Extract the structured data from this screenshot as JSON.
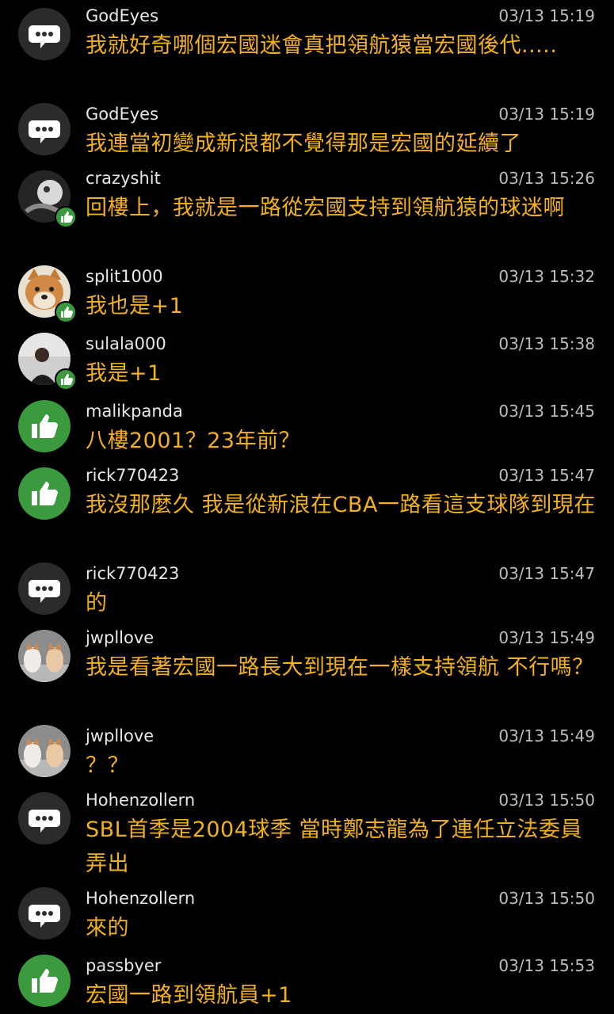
{
  "comments": [
    {
      "user": "GodEyes",
      "time": "03/13 15:19",
      "text": "我就好奇哪個宏國迷會真把領航猿當宏國後代.....",
      "avatar": "speech-bubble-icon",
      "badge": false
    },
    {
      "user": "GodEyes",
      "time": "03/13 15:19",
      "text": "我連當初變成新浪都不覺得那是宏國的延續了",
      "avatar": "speech-bubble-icon",
      "badge": false
    },
    {
      "user": "crazyshit",
      "time": "03/13 15:26",
      "text": "回樓上，我就是一路從宏國支持到領航猿的球迷啊",
      "avatar": "user-photo",
      "badge": true
    },
    {
      "user": "split1000",
      "time": "03/13 15:32",
      "text": "我也是+1",
      "avatar": "dog-photo",
      "badge": true
    },
    {
      "user": "sulala000",
      "time": "03/13 15:38",
      "text": "我是+1",
      "avatar": "user-photo",
      "badge": true
    },
    {
      "user": "malikpanda",
      "time": "03/13 15:45",
      "text": "八樓2001？23年前？",
      "avatar": "thumbs-up-icon",
      "badge": false
    },
    {
      "user": "rick770423",
      "time": "03/13 15:47",
      "text": "我沒那麼久 我是從新浪在CBA一路看這支球隊到現在",
      "avatar": "thumbs-up-icon",
      "badge": false
    },
    {
      "user": "rick770423",
      "time": "03/13 15:47",
      "text": "的",
      "avatar": "speech-bubble-icon",
      "badge": false
    },
    {
      "user": "jwpllove",
      "time": "03/13 15:49",
      "text": "我是看著宏國一路長大到現在一樣支持領航 不行嗎？",
      "avatar": "cats-photo",
      "badge": false
    },
    {
      "user": "jwpllove",
      "time": "03/13 15:49",
      "text": "？？",
      "avatar": "cats-photo",
      "badge": false
    },
    {
      "user": "Hohenzollern",
      "time": "03/13 15:50",
      "text": "SBL首季是2004球季 當時鄭志龍為了連任立法委員弄出",
      "avatar": "speech-bubble-icon",
      "badge": false
    },
    {
      "user": "Hohenzollern",
      "time": "03/13 15:50",
      "text": "來的",
      "avatar": "speech-bubble-icon",
      "badge": false
    },
    {
      "user": "passbyer",
      "time": "03/13 15:53",
      "text": "宏國一路到領航員+1",
      "avatar": "thumbs-up-icon",
      "badge": false
    }
  ],
  "colors": {
    "background": "#000000",
    "message": "#f2b01e",
    "username": "#e8e8e8",
    "timestamp": "#bdbdbd",
    "like_green": "#3b9a3e",
    "bubble_gray": "#2b2b2b"
  }
}
